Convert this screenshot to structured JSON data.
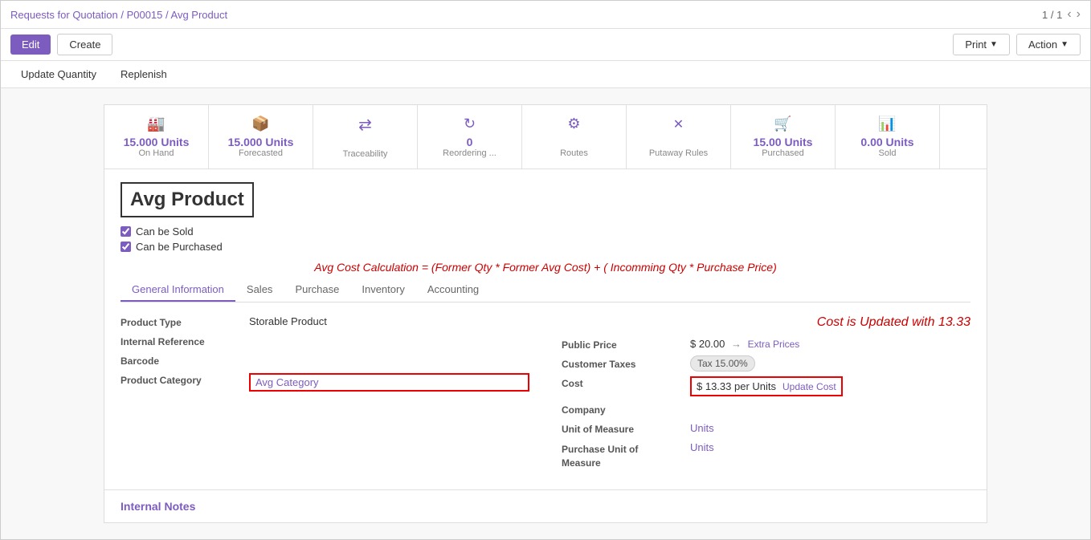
{
  "breadcrumb": {
    "path": "Requests for Quotation / P00015 / Avg Product",
    "parts": [
      "Requests for Quotation",
      "P00015",
      "Avg Product"
    ]
  },
  "pagination": {
    "current": "1",
    "total": "1",
    "display": "1 / 1"
  },
  "toolbar": {
    "edit_label": "Edit",
    "create_label": "Create",
    "print_label": "Print",
    "action_label": "Action"
  },
  "sub_toolbar": {
    "update_qty_label": "Update Quantity",
    "replenish_label": "Replenish"
  },
  "smart_buttons": [
    {
      "id": "on-hand",
      "icon": "🏭",
      "value": "15.000 Units",
      "label": "On Hand"
    },
    {
      "id": "forecasted",
      "icon": "📦",
      "value": "15.000 Units",
      "label": "Forecasted"
    },
    {
      "id": "traceability",
      "icon": "⇄",
      "value": "",
      "label": "Traceability"
    },
    {
      "id": "reordering",
      "icon": "🔄",
      "value": "0",
      "label": "Reordering ..."
    },
    {
      "id": "routes",
      "icon": "⚙",
      "value": "",
      "label": "Routes"
    },
    {
      "id": "putaway-rules",
      "icon": "✕",
      "value": "",
      "label": "Putaway Rules"
    },
    {
      "id": "purchased",
      "icon": "🛒",
      "value": "15.00 Units",
      "label": "Purchased"
    },
    {
      "id": "units-sold",
      "icon": "📊",
      "value": "0.00 Units",
      "label": "Sold"
    }
  ],
  "product": {
    "name": "Avg Product",
    "can_be_sold": true,
    "can_be_sold_label": "Can be Sold",
    "can_be_purchased": true,
    "can_be_purchased_label": "Can be Purchased"
  },
  "formula": {
    "text": "Avg Cost Calculation = (Former Qty * Former Avg Cost) + ( Incomming Qty * Purchase Price)"
  },
  "tabs": [
    {
      "id": "general",
      "label": "General Information",
      "active": true
    },
    {
      "id": "sales",
      "label": "Sales"
    },
    {
      "id": "purchase",
      "label": "Purchase"
    },
    {
      "id": "inventory",
      "label": "Inventory"
    },
    {
      "id": "accounting",
      "label": "Accounting"
    }
  ],
  "general_info": {
    "left_fields": [
      {
        "id": "product-type",
        "label": "Product Type",
        "value": "Storable Product",
        "is_link": false,
        "highlighted": false
      },
      {
        "id": "internal-reference",
        "label": "Internal Reference",
        "value": "",
        "is_link": false,
        "highlighted": false
      },
      {
        "id": "barcode",
        "label": "Barcode",
        "value": "",
        "is_link": false,
        "highlighted": false
      },
      {
        "id": "product-category",
        "label": "Product Category",
        "value": "Avg Category",
        "is_link": true,
        "highlighted": true
      }
    ],
    "right_fields": [
      {
        "id": "public-price",
        "label": "Public Price",
        "value": "$ 20.00",
        "has_extra": true,
        "extra_label": "Extra Prices"
      },
      {
        "id": "customer-taxes",
        "label": "Customer Taxes",
        "badge": "Tax 15.00%"
      },
      {
        "id": "cost",
        "label": "Cost",
        "value": "$ 13.33 per Units",
        "has_update": true,
        "update_label": "Update Cost",
        "highlighted": true
      },
      {
        "id": "company",
        "label": "Company",
        "value": ""
      },
      {
        "id": "unit-of-measure",
        "label": "Unit of Measure",
        "value": "Units",
        "is_link": true
      },
      {
        "id": "purchase-unit-of-measure",
        "label": "Purchase Unit of\nMeasure",
        "value": "Units",
        "is_link": true
      }
    ]
  },
  "cost_updated_note": "Cost is Updated with 13.33",
  "internal_notes": {
    "title": "Internal Notes"
  }
}
